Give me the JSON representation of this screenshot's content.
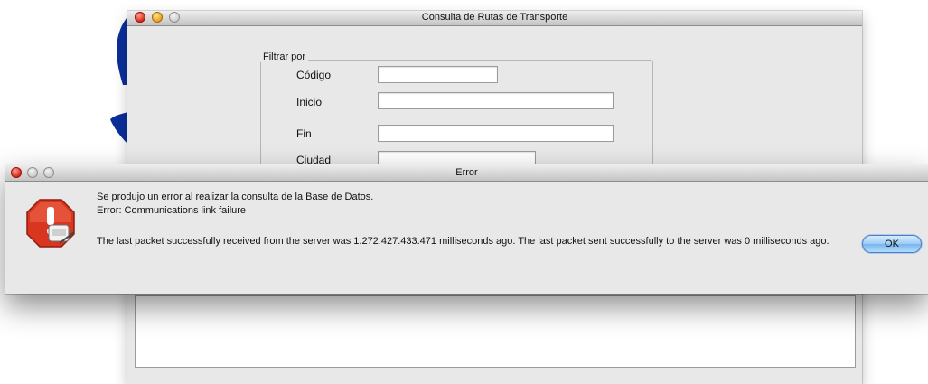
{
  "main_window": {
    "title": "Consulta de Rutas de Transporte",
    "filter": {
      "legend": "Filtrar por",
      "fields": [
        {
          "label": "Código",
          "value": ""
        },
        {
          "label": "Inicio",
          "value": ""
        },
        {
          "label": "Fin",
          "value": ""
        },
        {
          "label": "Ciudad",
          "value": ""
        }
      ]
    }
  },
  "error_dialog": {
    "title": "Error",
    "message_line1": "Se produjo un error al realizar la consulta de la Base de Datos.",
    "message_line2": "Error: Communications link failure",
    "message_line3": "The last packet successfully received from the server was 1.272.427.433.471 milliseconds ago.  The last packet sent successfully to the server was 0 milliseconds ago.",
    "ok_label": "OK",
    "icon": "alert-stop-icon"
  },
  "colors": {
    "window_background": "#e8e8e8",
    "close_button": "#d01a10",
    "minimize_button": "#e69a10",
    "default_button": "#78b4ee",
    "alert_icon": "#d8361e",
    "background_shape": "#0a2f9a"
  }
}
